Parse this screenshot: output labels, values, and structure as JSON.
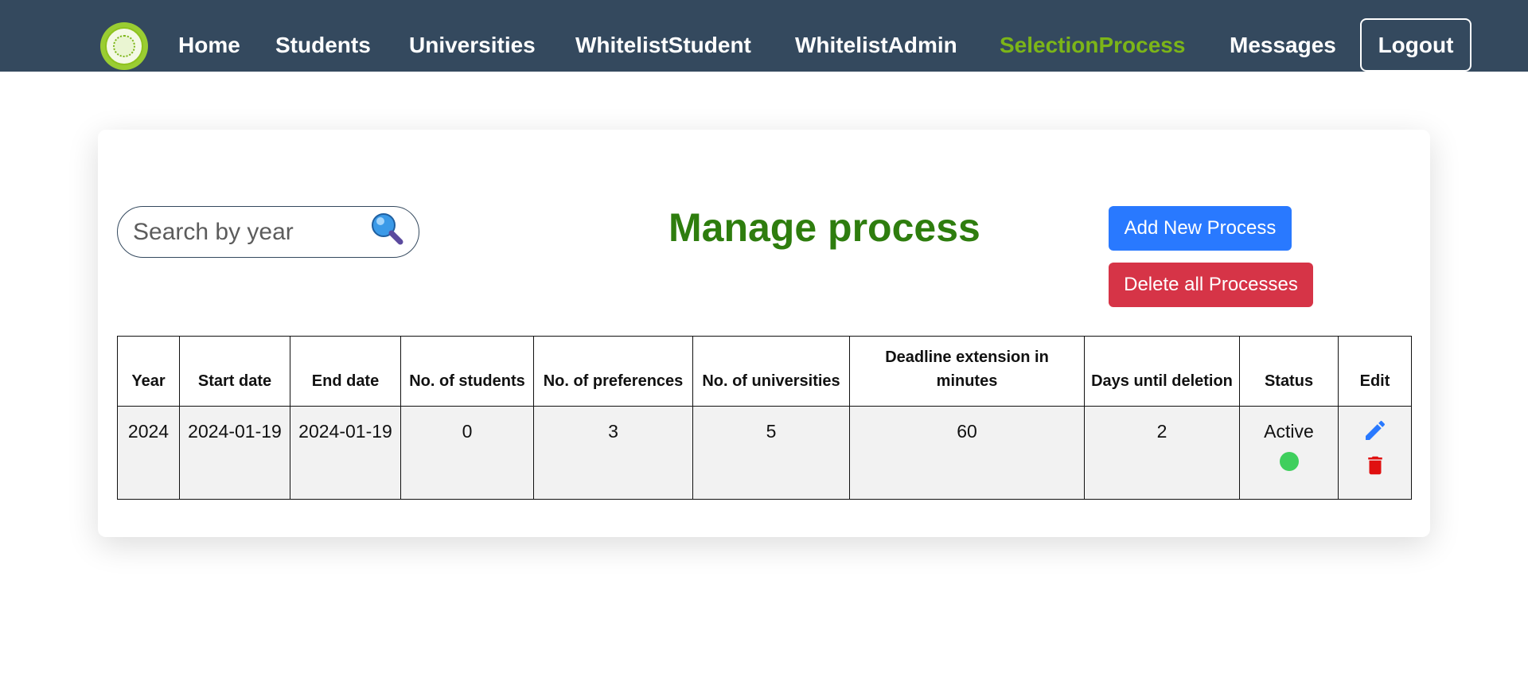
{
  "nav": {
    "logo": "logo-icon",
    "links": [
      {
        "label": "Home",
        "active": false
      },
      {
        "label": "Students",
        "active": false
      },
      {
        "label": "Universities",
        "active": false
      },
      {
        "label": "WhitelistStudent",
        "active": false
      },
      {
        "label": "WhitelistAdmin",
        "active": false
      },
      {
        "label": "SelectionProcess",
        "active": true
      },
      {
        "label": "Messages",
        "active": false
      }
    ],
    "logout_label": "Logout",
    "colors": {
      "background": "#34495e",
      "active_link": "#7cb518"
    }
  },
  "search": {
    "placeholder": "Search by year",
    "value": "",
    "icon": "magnifier-icon"
  },
  "main": {
    "title": "Manage process",
    "title_color": "#2e7d0e",
    "add_button_label": "Add New Process",
    "delete_all_button_label": "Delete all Processes",
    "button_colors": {
      "add": "#2979ff",
      "delete": "#d63447"
    }
  },
  "table": {
    "headers": {
      "year": "Year",
      "start_date": "Start date",
      "end_date": "End date",
      "students": "No. of students",
      "preferences": "No. of preferences",
      "universities": "No. of universities",
      "deadline": "Deadline extension in minutes",
      "days_until_deletion": "Days until deletion",
      "status": "Status",
      "edit": "Edit"
    },
    "rows": [
      {
        "year": "2024",
        "start_date": "2024-01-19",
        "end_date": "2024-01-19",
        "students": "0",
        "preferences": "3",
        "universities": "5",
        "deadline": "60",
        "days_until_deletion": "2",
        "status": "Active",
        "status_color": "#3fcf5d",
        "edit_icon": "pencil-icon",
        "delete_icon": "trash-icon"
      }
    ]
  }
}
